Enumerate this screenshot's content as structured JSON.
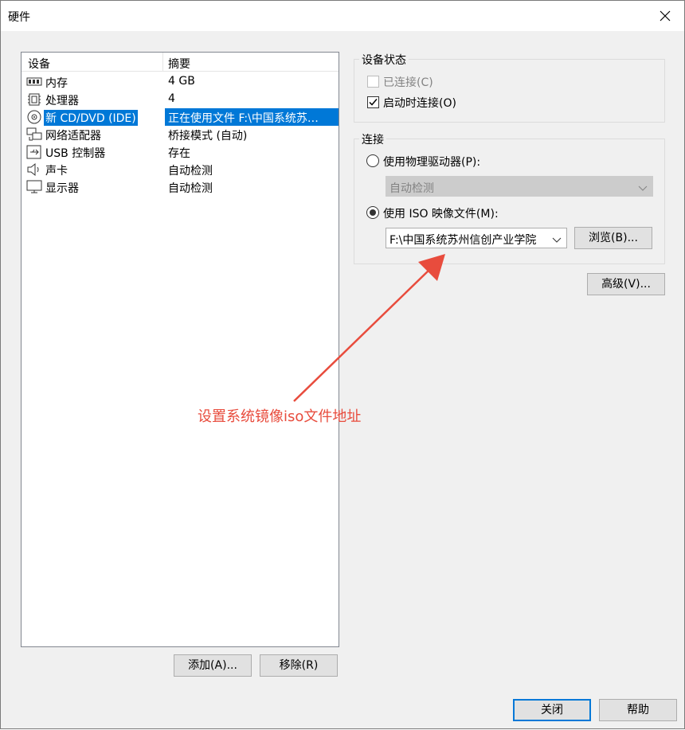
{
  "window": {
    "title": "硬件"
  },
  "device_list": {
    "headers": {
      "device": "设备",
      "summary": "摘要"
    },
    "rows": [
      {
        "icon": "memory-icon",
        "name": "内存",
        "summary": "4 GB"
      },
      {
        "icon": "cpu-icon",
        "name": "处理器",
        "summary": "4"
      },
      {
        "icon": "cd-dvd-icon",
        "name": "新 CD/DVD (IDE)",
        "summary": "正在使用文件 F:\\中国系统苏…"
      },
      {
        "icon": "network-icon",
        "name": "网络适配器",
        "summary": "桥接模式 (自动)"
      },
      {
        "icon": "usb-icon",
        "name": "USB 控制器",
        "summary": "存在"
      },
      {
        "icon": "speaker-icon",
        "name": "声卡",
        "summary": "自动检测"
      },
      {
        "icon": "monitor-icon",
        "name": "显示器",
        "summary": "自动检测"
      }
    ],
    "selected_index": 2
  },
  "buttons": {
    "add": "添加(A)...",
    "remove": "移除(R)",
    "close": "关闭",
    "help": "帮助",
    "browse": "浏览(B)...",
    "advanced": "高级(V)..."
  },
  "device_status": {
    "title": "设备状态",
    "connected": {
      "label": "已连接(C)",
      "checked": false,
      "disabled": true
    },
    "connect_at_power_on": {
      "label": "启动时连接(O)",
      "checked": true
    }
  },
  "connection": {
    "title": "连接",
    "physical_drive": {
      "label": "使用物理驱动器(P):",
      "selected": false
    },
    "physical_drive_select": {
      "value": "自动检测",
      "disabled": true
    },
    "iso_image": {
      "label": "使用 ISO 映像文件(M):",
      "selected": true
    },
    "iso_path": {
      "value": "F:\\中国系统苏州信创产业学院"
    }
  },
  "annotation": {
    "text": "设置系统镜像iso文件地址",
    "color": "#e84c3d"
  },
  "colors": {
    "selection": "#0078d7",
    "dialog_bg": "#f0f0f0",
    "annotation": "#e84c3d"
  }
}
